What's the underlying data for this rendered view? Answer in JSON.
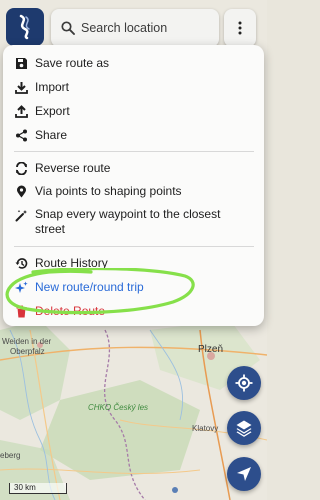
{
  "search": {
    "placeholder": "Search location"
  },
  "menu": {
    "items": [
      {
        "label": "Save route as",
        "icon": "save-icon"
      },
      {
        "label": "Import",
        "icon": "import-icon"
      },
      {
        "label": "Export",
        "icon": "export-icon"
      },
      {
        "label": "Share",
        "icon": "share-icon"
      },
      {
        "label": "Reverse route",
        "icon": "reverse-icon"
      },
      {
        "label": "Via points to shaping points",
        "icon": "location-pin-icon"
      },
      {
        "label": "Snap every waypoint to the closest street",
        "icon": "magic-wand-icon"
      },
      {
        "label": "Route History",
        "icon": "history-icon"
      },
      {
        "label": "New route/round trip",
        "icon": "sparkle-icon"
      },
      {
        "label": "Delete Route",
        "icon": "trash-icon"
      }
    ]
  },
  "map": {
    "labels": {
      "weiden": "Weiden in der",
      "oberpfalz": "Oberpfalz",
      "plzen": "Plzeň",
      "chko": "CHKO Český les",
      "klatovy": "Klatovy",
      "eberg": "eberg"
    },
    "scale": "30 km"
  },
  "colors": {
    "brand_navy": "#2d4e8c",
    "accent_blue": "#2a6bd8",
    "danger_red": "#d8343b",
    "highlight_green": "#86e04a"
  }
}
